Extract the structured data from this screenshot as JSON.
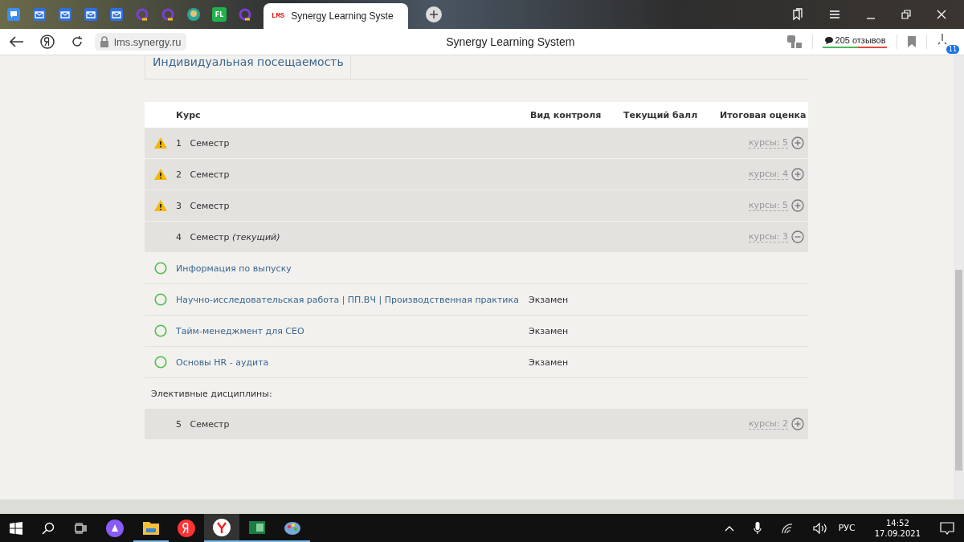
{
  "browser": {
    "pinned_tabs": [
      {
        "kind": "chat"
      },
      {
        "kind": "mail"
      },
      {
        "kind": "mail"
      },
      {
        "kind": "mail"
      },
      {
        "kind": "mail"
      },
      {
        "kind": "ring"
      },
      {
        "kind": "ring"
      },
      {
        "kind": "globe"
      },
      {
        "kind": "fl",
        "label": "FL"
      },
      {
        "kind": "ring"
      }
    ],
    "active_tab": {
      "logo": "LMS",
      "title": "Synergy Learning Syste"
    },
    "address": "lms.synergy.ru",
    "page_title": "Synergy Learning System",
    "reviews": "205 отзывов",
    "downloads_badge": "11"
  },
  "page": {
    "tab": "Индивидуальная посещаемость",
    "table": {
      "columns": [
        "Курс",
        "Вид контроля",
        "Текущий балл",
        "Итоговая оценка"
      ],
      "semesters": [
        {
          "number": "1",
          "label": "Семестр",
          "warning": true,
          "courses_count": "курсы: 5",
          "expanded": false
        },
        {
          "number": "2",
          "label": "Семестр",
          "warning": true,
          "courses_count": "курсы: 4",
          "expanded": false
        },
        {
          "number": "3",
          "label": "Семестр",
          "warning": true,
          "courses_count": "курсы: 5",
          "expanded": false
        },
        {
          "number": "4",
          "label": "Семестр",
          "note": "(текущий)",
          "warning": false,
          "courses_count": "курсы: 3",
          "expanded": true,
          "courses": [
            {
              "name": "Информация по выпуску"
            },
            {
              "name": "Научно-исследовательская работа | ПП.ВЧ | Производственная практика",
              "control": "Экзамен"
            },
            {
              "name": "Тайм-менеджмент для CEO",
              "control": "Экзамен"
            },
            {
              "name": "Основы HR - аудита",
              "control": "Экзамен"
            }
          ]
        }
      ],
      "electives_label": "Элективные дисциплины:",
      "electives": [
        {
          "number": "5",
          "label": "Семестр",
          "warning": false,
          "courses_count": "курсы: 2",
          "expanded": false
        }
      ]
    }
  },
  "taskbar": {
    "language": "РУС",
    "time": "14:52",
    "date": "17.09.2021"
  }
}
